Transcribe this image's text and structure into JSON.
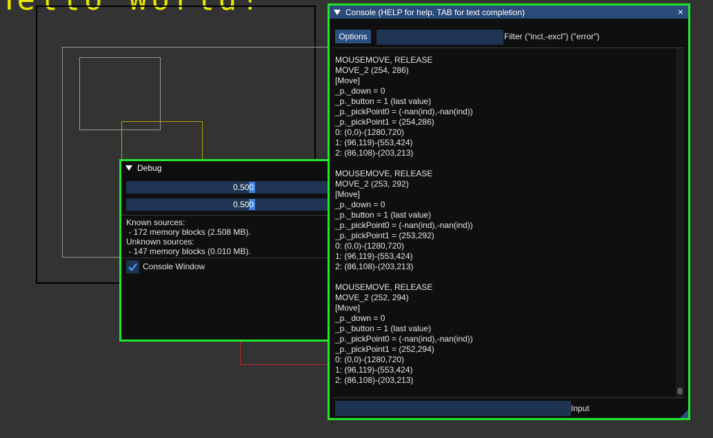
{
  "scene": {
    "hello_text": "Hello World!"
  },
  "debug_window": {
    "title": "Debug",
    "slider1_value": "0.500",
    "slider2_value": "0.500",
    "known_sources_label": "Known sources:",
    "known_sources_detail": " - 172 memory blocks (2.508 MB).",
    "unknown_sources_label": "Unknown sources:",
    "unknown_sources_detail": " - 147 memory blocks (0.010 MB).",
    "checkbox_label": "Console Window",
    "checkbox_checked": true
  },
  "console_window": {
    "title": "Console (HELP for help, TAB for text completion)",
    "close_glyph": "×",
    "options_label": "Options",
    "filter_value": "",
    "filter_label": "Filter (\"incl,-excl\") (\"error\")",
    "input_value": "",
    "input_label": "Input",
    "log": [
      "MOUSEMOVE, RELEASE",
      "MOVE_2 (254, 286)",
      "[Move]",
      "_p._down = 0",
      "_p._button = 1 (last value)",
      "_p._pickPoint0 = (-nan(ind),-nan(ind))",
      "_p._pickPoint1 = (254,286)",
      "0: (0,0)-(1280,720)",
      "1: (96,119)-(553,424)",
      "2: (86,108)-(203,213)",
      "",
      "MOUSEMOVE, RELEASE",
      "MOVE_2 (253, 292)",
      "[Move]",
      "_p._down = 0",
      "_p._button = 1 (last value)",
      "_p._pickPoint0 = (-nan(ind),-nan(ind))",
      "_p._pickPoint1 = (253,292)",
      "0: (0,0)-(1280,720)",
      "1: (96,119)-(553,424)",
      "2: (86,108)-(203,213)",
      "",
      "MOUSEMOVE, RELEASE",
      "MOVE_2 (252, 294)",
      "[Move]",
      "_p._down = 0",
      "_p._button = 1 (last value)",
      "_p._pickPoint0 = (-nan(ind),-nan(ind))",
      "_p._pickPoint1 = (252,294)",
      "0: (0,0)-(1280,720)",
      "1: (96,119)-(553,424)",
      "2: (86,108)-(203,213)"
    ]
  },
  "colors": {
    "window_border": "#22e62e",
    "title_active": "#2a4a7a",
    "frame_bg": "#1f3452",
    "button": "#2a4f82",
    "hello_text": "#e8e800"
  }
}
